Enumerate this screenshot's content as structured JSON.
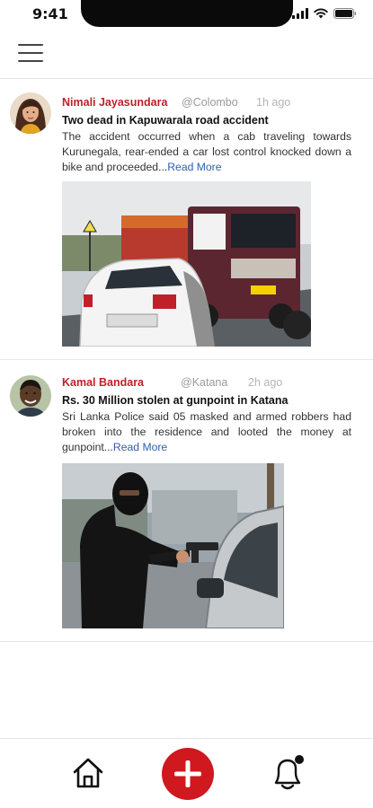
{
  "status_bar": {
    "time": "9:41",
    "icons": [
      "cellular-signal-icon",
      "wifi-icon",
      "battery-icon"
    ]
  },
  "header": {
    "menu_icon": "hamburger-menu-icon"
  },
  "posts": [
    {
      "author": "Nimali Jayasundara",
      "location": "@Colombo",
      "time": "1h ago",
      "headline": "Two dead in Kapuwarala road accident",
      "excerpt": "The accident occurred when a cab traveling towards Kurunegala, rear-ended a car lost control knocked down a bike and proceeded...",
      "read_more": "Read More"
    },
    {
      "author": "Kamal Bandara",
      "location": "@Katana",
      "time": "2h ago",
      "headline": "Rs. 30 Million stolen at gunpoint in Katana",
      "excerpt": "Sri Lanka Police said 05 masked and armed robbers had broken into the residence and looted the money at gunpoint...",
      "read_more": "Read More"
    }
  ],
  "bottom_nav": {
    "items": [
      "home-icon",
      "add-icon",
      "notification-bell-icon"
    ]
  },
  "colors": {
    "accent": "#d0181f",
    "author": "#c0202a",
    "link": "#2f5fae"
  }
}
